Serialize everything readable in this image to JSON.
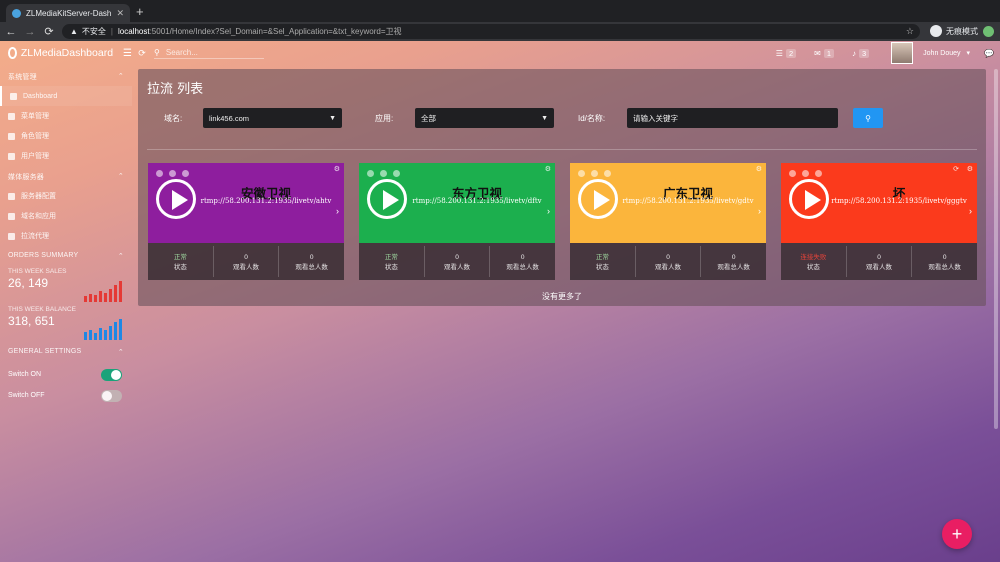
{
  "browser": {
    "tab_title": "ZLMediaKitServer-Dashboard",
    "tab_close": "✕",
    "new_tab": "+",
    "security": "不安全",
    "url_host": "localhost",
    "url_path": ":5001/Home/Index?Sel_Domain=&Sel_Application=&txt_keyword=卫视",
    "incognito_label": "无痕模式"
  },
  "topbar": {
    "brand": "ZLMediaDashboard",
    "search_placeholder": "Search...",
    "tasks_count": "2",
    "messages_count": "1",
    "alerts_count": "3",
    "user_name": "John Douey"
  },
  "sidebar": {
    "section_system": "系统管理",
    "items_system": [
      {
        "label": "Dashboard"
      },
      {
        "label": "菜单管理"
      },
      {
        "label": "角色管理"
      },
      {
        "label": "用户管理"
      }
    ],
    "section_media": "媒体服务器",
    "items_media": [
      {
        "label": "服务器配置"
      },
      {
        "label": "域名和应用"
      },
      {
        "label": "拉流代理"
      }
    ],
    "orders_summary": "ORDERS SUMMARY",
    "sales_label": "THIS WEEK SALES",
    "sales_value": "26, 149",
    "balance_label": "THIS WEEK BALANCE",
    "balance_value": "318, 651",
    "general_settings": "GENERAL SETTINGS",
    "switch_on_label": "Switch ON",
    "switch_off_label": "Switch OFF"
  },
  "main": {
    "title": "拉流 列表",
    "domain_label": "域名:",
    "domain_value": "link456.com",
    "app_label": "应用:",
    "app_value": "全部",
    "id_label": "Id/名称:",
    "id_placeholder": "请输入关键字",
    "no_more": "没有更多了"
  },
  "cards": [
    {
      "name": "安徽卫视",
      "url": "rtmp://58.200.131.2:1935/livetv/ahtv",
      "status": "正常",
      "status_label": "状态",
      "viewers": "0",
      "viewers_label": "观看人数",
      "total": "0",
      "total_label": "观看总人数",
      "color": "#8e1e9e",
      "status_color": "#9fd79f"
    },
    {
      "name": "东方卫视",
      "url": "rtmp://58.200.131.2:1935/livetv/dftv",
      "status": "正常",
      "status_label": "状态",
      "viewers": "0",
      "viewers_label": "观看人数",
      "total": "0",
      "total_label": "观看总人数",
      "color": "#1caf4e",
      "status_color": "#9fd79f"
    },
    {
      "name": "广东卫视",
      "url": "rtmp://58.200.131.2:1935/livetv/gdtv",
      "status": "正常",
      "status_label": "状态",
      "viewers": "0",
      "viewers_label": "观看人数",
      "total": "0",
      "total_label": "观看总人数",
      "color": "#fbb53c",
      "status_color": "#9fd79f"
    },
    {
      "name": "坏",
      "url": "rtmp://58.200.131.2:1935/livetv/gggtv",
      "status": "连接失败",
      "status_label": "状态",
      "viewers": "0",
      "viewers_label": "观看人数",
      "total": "0",
      "total_label": "观看总人数",
      "color": "#fb3a1c",
      "status_color": "#e0433a"
    }
  ],
  "sales_spark": [
    0.25,
    0.35,
    0.3,
    0.5,
    0.4,
    0.6,
    0.75,
    0.95
  ],
  "balance_spark": [
    0.35,
    0.45,
    0.3,
    0.55,
    0.45,
    0.65,
    0.8,
    0.95
  ]
}
